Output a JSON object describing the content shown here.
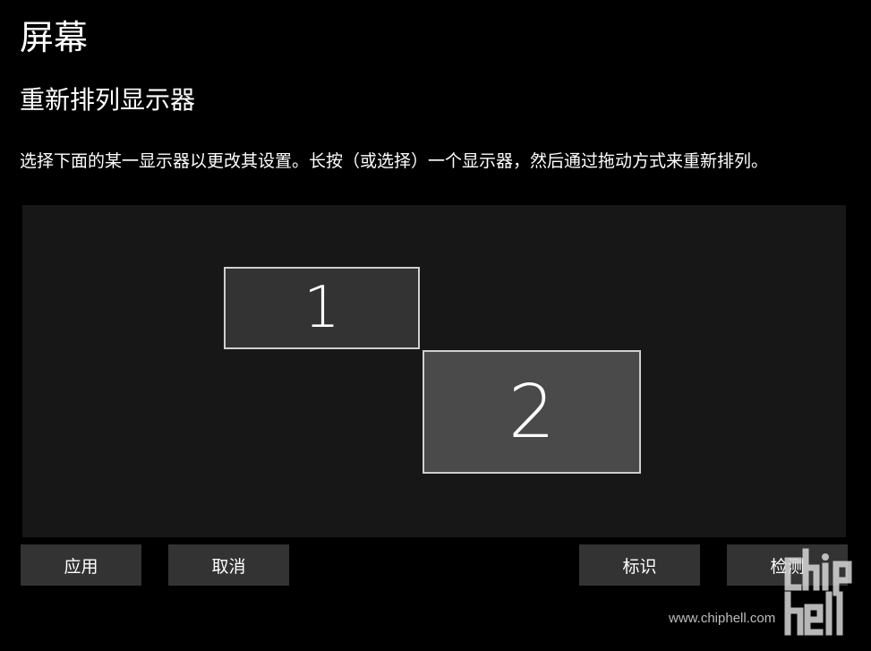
{
  "header": {
    "title": "屏幕",
    "subtitle": "重新排列显示器",
    "description": "选择下面的某一显示器以更改其设置。长按（或选择）一个显示器，然后通过拖动方式来重新排列。"
  },
  "monitors": [
    {
      "label": "1",
      "selected": false
    },
    {
      "label": "2",
      "selected": true
    }
  ],
  "buttons": {
    "apply": "应用",
    "cancel": "取消",
    "identify": "标识",
    "detect": "检测"
  },
  "watermark": {
    "text": "www.chiphell.com",
    "logo": "chiphell"
  },
  "colors": {
    "background": "#000000",
    "arrange_area": "#171717",
    "monitor_1": "#333333",
    "monitor_2": "#4a4a4a",
    "button": "#333333",
    "monitor_border": "#cfcfcf"
  }
}
